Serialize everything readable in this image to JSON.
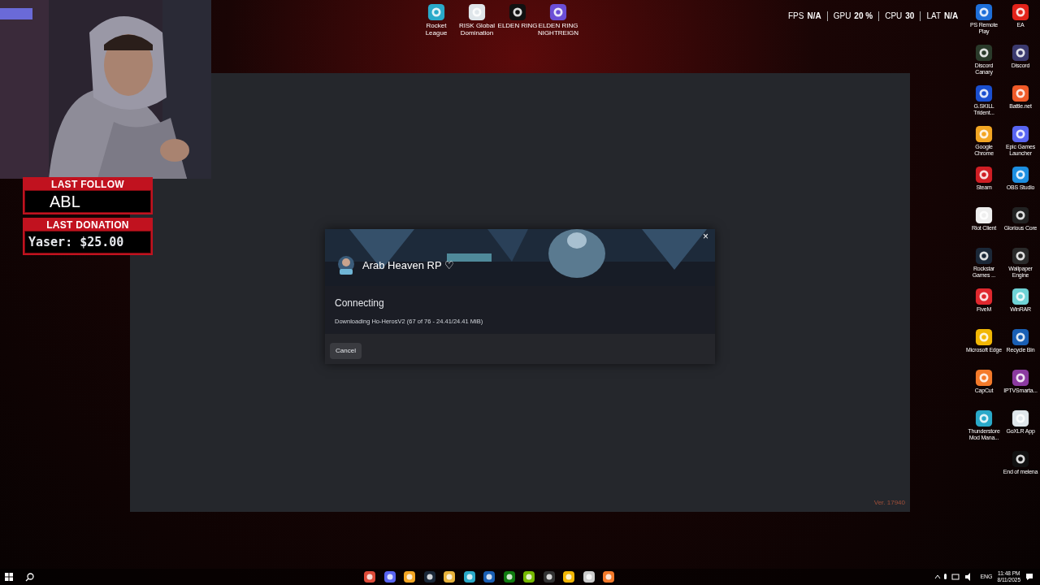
{
  "stream_overlay": {
    "last_follow": {
      "title": "LAST FOLLOW",
      "value": "ABL"
    },
    "last_donation": {
      "title": "LAST DONATION",
      "value": "Yaser: $25.00"
    }
  },
  "top_icons": [
    {
      "label": "Rocket League"
    },
    {
      "label": "RISK Global Domination"
    },
    {
      "label": "ELDEN RING"
    },
    {
      "label": "ELDEN RING NIGHTREIGN"
    }
  ],
  "performance_overlay": [
    {
      "label": "FPS",
      "value": "N/A"
    },
    {
      "label": "GPU",
      "value": "20 %"
    },
    {
      "label": "CPU",
      "value": "30"
    },
    {
      "label": "LAT",
      "value": "N/A"
    }
  ],
  "desktop_icons": [
    {
      "label": "PS Remote Play"
    },
    {
      "label": "EA"
    },
    {
      "label": "Discord Canary"
    },
    {
      "label": "Discord"
    },
    {
      "label": "G.SKILL Trident..."
    },
    {
      "label": "Battle.net"
    },
    {
      "label": "Google Chrome"
    },
    {
      "label": "Epic Games Launcher"
    },
    {
      "label": "Steam"
    },
    {
      "label": "OBS Studio"
    },
    {
      "label": "Riot Client"
    },
    {
      "label": "Glorious Core"
    },
    {
      "label": "Rockstar Games ..."
    },
    {
      "label": "Wallpaper Engine"
    },
    {
      "label": "FiveM"
    },
    {
      "label": "WinRAR"
    },
    {
      "label": "Microsoft Edge"
    },
    {
      "label": "Recycle Bin"
    },
    {
      "label": "CapCut"
    },
    {
      "label": "IPTVSmarta..."
    },
    {
      "label": "Thunderstore Mod Mana..."
    },
    {
      "label": "GoXLR App"
    },
    {
      "label": "End of melena"
    }
  ],
  "launcher": {
    "version": "Ver. 17940",
    "dialog": {
      "server_name": "Arab Heaven RP ♡",
      "close": "×",
      "status": "Connecting",
      "progress": "Downloading Ho-HerosV2 (67 of 76 - 24.41/24.41 MiB)",
      "button": "Cancel"
    }
  },
  "taskbar": {
    "language": "ENG",
    "time": "11:48 PM",
    "date": "8/11/2025"
  }
}
